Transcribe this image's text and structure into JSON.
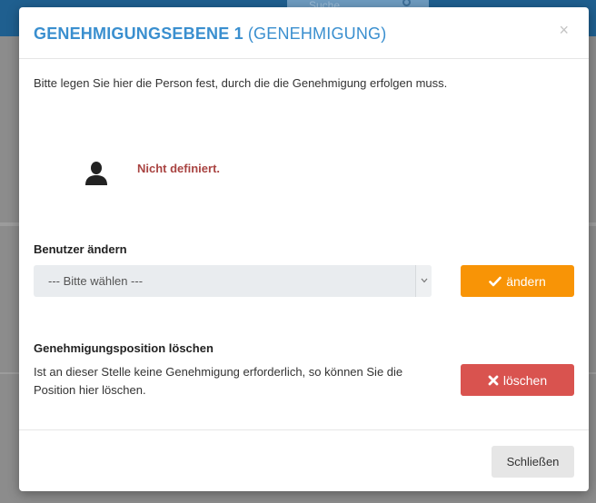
{
  "background": {
    "search_placeholder": "Suche"
  },
  "dialog": {
    "title_main": "GENEHMIGUNGSEBENE 1",
    "title_sub": "(GENEHMIGUNG)",
    "close_symbol": "×",
    "intro": "Bitte legen Sie hier die Person fest, durch die die Genehmigung erfolgen muss.",
    "assignee_status": "Nicht definiert.",
    "change_user": {
      "label": "Benutzer ändern",
      "select_value": "--- Bitte wählen ---",
      "button_label": "ändern"
    },
    "delete_position": {
      "label": "Genehmigungsposition löschen",
      "description": "Ist an dieser Stelle keine Genehmigung erforderlich, so können Sie die Position hier löschen.",
      "button_label": "löschen"
    },
    "footer": {
      "close_label": "Schließen"
    }
  },
  "colors": {
    "title": "#3a8fcf",
    "status_text": "#a94442",
    "change_button": "#f89406",
    "delete_button": "#d9534f",
    "footer_button": "#e6e6e6",
    "select_background": "#e9ecef"
  },
  "icons": {
    "close": "close-icon",
    "person": "user-silhouette-icon",
    "dropdown": "chevron-down-icon",
    "change": "check-icon",
    "delete": "x-mark-icon",
    "search": "search-icon"
  }
}
